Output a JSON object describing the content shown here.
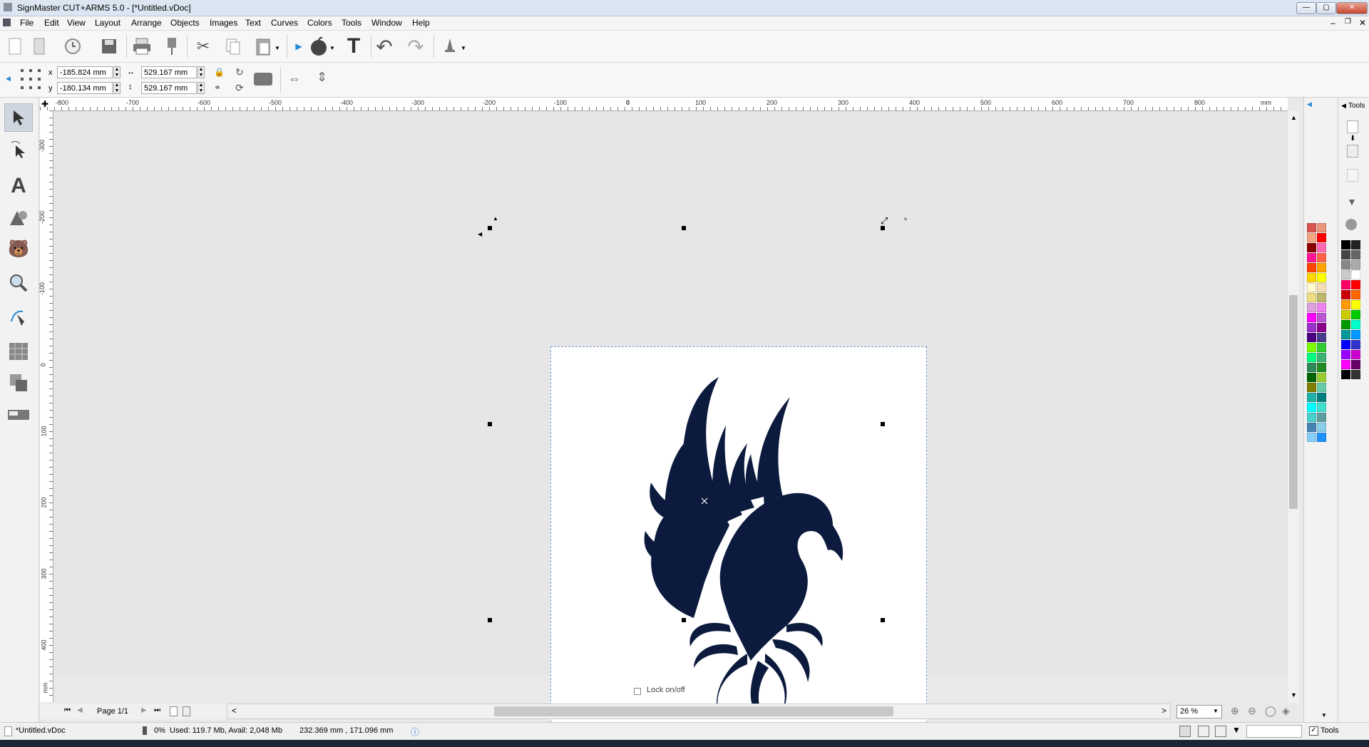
{
  "app": {
    "title": "SignMaster CUT+ARMS 5.0 - [*Untitled.vDoc]"
  },
  "menu": [
    "File",
    "Edit",
    "View",
    "Layout",
    "Arrange",
    "Objects",
    "Images",
    "Text",
    "Curves",
    "Colors",
    "Tools",
    "Window",
    "Help"
  ],
  "toolbar1": {
    "icons": [
      "new-file-icon",
      "open-file-icon",
      "recent-icon",
      "save-icon",
      "print-icon",
      "cut-plot-icon",
      "scissors-icon",
      "copy-icon",
      "paste-icon",
      "send-arrow-icon",
      "apple-icon",
      "text-t-icon",
      "undo-icon",
      "redo-icon",
      "bell-icon"
    ]
  },
  "properties": {
    "x_label": "x",
    "y_label": "y",
    "x_value": "-185.824 mm",
    "y_value": "-180.134 mm",
    "width_value": "529.167 mm",
    "height_value": "529.167 mm"
  },
  "ruler": {
    "h_ticks": [
      "-800",
      "-700",
      "-600",
      "-500",
      "-400",
      "-300",
      "-200",
      "-100",
      "0",
      "100",
      "200",
      "300",
      "400",
      "500",
      "600",
      "700",
      "800",
      "mm"
    ],
    "v_ticks": [
      "-300",
      "-200",
      "-100",
      "0",
      "100",
      "200",
      "300",
      "400",
      "mm"
    ]
  },
  "canvas": {
    "lock_label": "Lock on/off"
  },
  "pagebar": {
    "page_label": "Page 1/1"
  },
  "zoom": {
    "value": "26 %"
  },
  "status": {
    "doc_name": "*Untitled.vDoc",
    "progress": "0%",
    "memory": "Used: 119.7 Mb, Avail: 2,048 Mb",
    "coords": "232.369 mm , 171.096 mm",
    "tools_label": "Tools"
  },
  "toolspanel": {
    "header": "Tools"
  },
  "colors": {
    "accent": "#7a9bd3",
    "artwork": "#0b1a3d",
    "palette_left": [
      "#d9534f",
      "#e9967a",
      "#f4a582",
      "#ff0000",
      "#8b0000",
      "#ff69b4",
      "#ff1493",
      "#ff6347",
      "#ff4500",
      "#ffa500",
      "#ffd700",
      "#ffff00",
      "#fffacd",
      "#f5deb3",
      "#eedd82",
      "#bdb76b",
      "#dda0dd",
      "#ee82ee",
      "#ff00ff",
      "#ba55d3",
      "#9932cc",
      "#8b008b",
      "#4b0082",
      "#483d8b",
      "#7cfc00",
      "#32cd32",
      "#00ff7f",
      "#3cb371",
      "#2e8b57",
      "#228b22",
      "#006400",
      "#9acd32",
      "#808000",
      "#66cdaa",
      "#20b2aa",
      "#008080",
      "#00ffff",
      "#40e0d0",
      "#48d1cc",
      "#5f9ea0",
      "#4682b4",
      "#87ceeb",
      "#87cefa",
      "#1e90ff"
    ],
    "palette_right": [
      "#000000",
      "#222222",
      "#444444",
      "#666666",
      "#888888",
      "#aaaaaa",
      "#cccccc",
      "#ffffff",
      "#ff0066",
      "#ff0000",
      "#cc0000",
      "#ff6600",
      "#ff9900",
      "#ffff00",
      "#cccc00",
      "#00cc00",
      "#009900",
      "#00ffcc",
      "#009999",
      "#0099ff",
      "#0000ff",
      "#3333cc",
      "#9900ff",
      "#cc00cc",
      "#ff00ff",
      "#660066",
      "#000000",
      "#333333"
    ]
  }
}
